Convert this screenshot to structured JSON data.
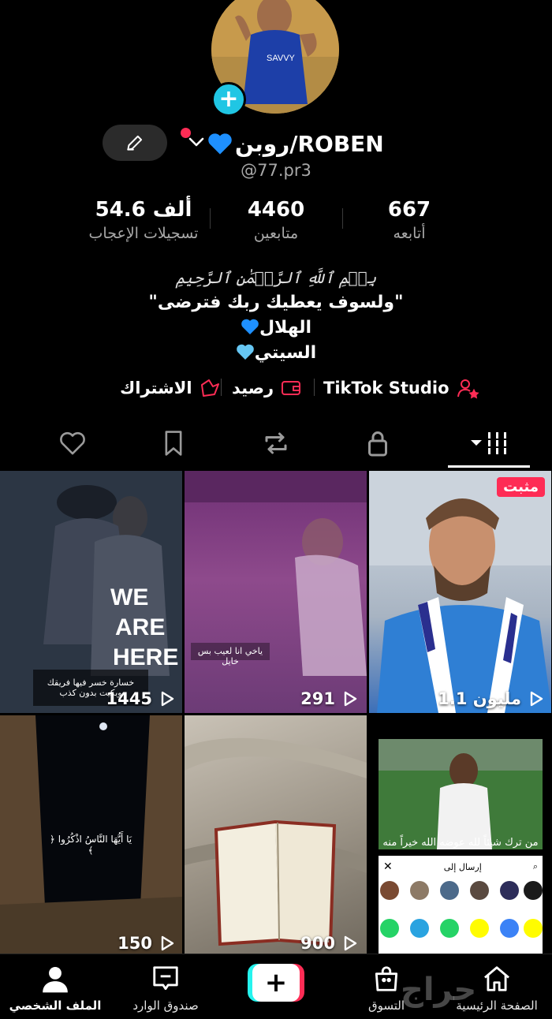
{
  "profile": {
    "display_name": "روبن/ROBEN",
    "username": "@77.pr3",
    "add_icon": "+",
    "stats": [
      {
        "value": "54.6 ألف",
        "label": "تسجيلات الإعجاب"
      },
      {
        "value": "4460",
        "label": "متابعين"
      },
      {
        "value": "667",
        "label": "أتابعه"
      }
    ],
    "bio": {
      "basmala": "بِسۡمِ ٱللَّهِ ٱلرَّحۡمَٰنِ ٱلرَّحِيمِ",
      "line1": "\"ولسوف يعطيك ربك فترضى\"",
      "line2": "الهلال",
      "line3": "السيتي"
    },
    "links": {
      "studio": "TikTok Studio",
      "balance": "رصيد",
      "subscription": "الاشتراك"
    }
  },
  "colors": {
    "accent_red": "#fe2c55",
    "accent_cyan": "#25f4ee",
    "heart_blue": "#1e90ff",
    "heart_light_blue": "#66c7f4"
  },
  "tabs": [
    {
      "icon": "liked-heart-icon"
    },
    {
      "icon": "bookmark-icon"
    },
    {
      "icon": "repost-icon"
    },
    {
      "icon": "lock-icon"
    },
    {
      "icon": "grid-videos-icon",
      "active": true
    }
  ],
  "videos": [
    {
      "views": "1445",
      "caption": "خسارة خسر فيها فريقك وبكيت بدون كذب",
      "poster_text": "WE ARE HERE"
    },
    {
      "views": "291",
      "caption": "ياخي انا لعيب بس خايل"
    },
    {
      "views": "1.1 مليون",
      "pinned": "مثبت"
    },
    {
      "views": "150",
      "caption": "﴿ يَا أَيُّهَا النَّاسُ اذْكُرُوا ﴾"
    },
    {
      "views": "900"
    },
    {
      "views": "",
      "caption": "من ترك شيئاً لله عوضه الله خيراً منه",
      "share_title": "إرسال إلى"
    }
  ],
  "bottom_nav": [
    {
      "label": "الملف الشخصي",
      "icon": "profile-icon",
      "active": true
    },
    {
      "label": "صندوق الوارد",
      "icon": "inbox-icon"
    },
    {
      "label": "",
      "icon": "create-icon",
      "plus": "+"
    },
    {
      "label": "التسوق",
      "icon": "shop-icon"
    },
    {
      "label": "الصفحة الرئيسية",
      "icon": "home-icon"
    }
  ],
  "watermark": "حراج"
}
